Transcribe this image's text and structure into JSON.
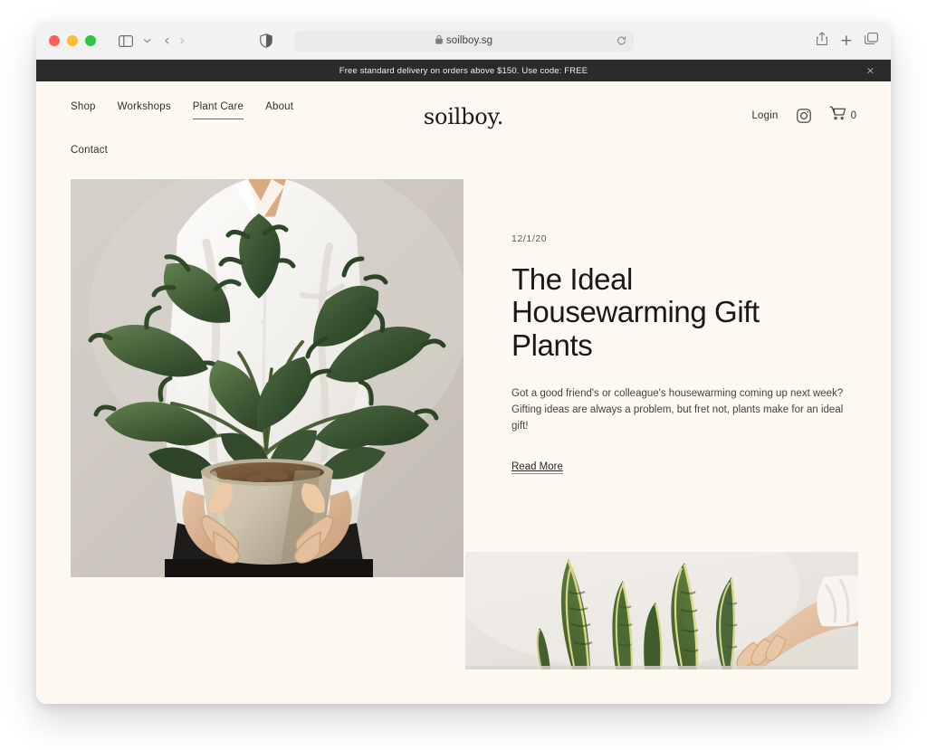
{
  "browser": {
    "url": "soilboy.sg",
    "lock_icon": "lock-icon",
    "traffic_lights": [
      "close",
      "minimize",
      "maximize"
    ],
    "sidebar_icon": "sidebar-toggle-icon",
    "sidebar_chevron_icon": "chevron-down-icon",
    "back_icon": "‹",
    "forward_icon": "›",
    "shield_icon": "privacy-shield-icon",
    "reload_icon": "reload-icon",
    "share_icon": "share-icon",
    "new_tab_icon": "+",
    "tabs_icon": "tab-overview-icon"
  },
  "announcement": {
    "text": "Free standard delivery on orders above $150. Use code: FREE",
    "close_label": "×",
    "background": "#2b2b2b",
    "text_color": "#f2f0ec"
  },
  "header": {
    "brand": "soilboy.",
    "nav": [
      {
        "label": "Shop",
        "active": false
      },
      {
        "label": "Workshops",
        "active": false
      },
      {
        "label": "Plant Care",
        "active": true
      },
      {
        "label": "About",
        "active": false
      },
      {
        "label": "Contact",
        "active": false
      }
    ],
    "login_label": "Login",
    "instagram_icon": "instagram-icon",
    "cart_icon": "shopping-cart-icon",
    "cart_count": "0"
  },
  "article": {
    "date": "12/1/20",
    "title": "The Ideal Housewarming Gift Plants",
    "excerpt": "Got a good friend's or colleague's housewarming coming up next week? Gifting ideas are always a problem, but fret not, plants make for an ideal gift!",
    "read_more_label": "Read More",
    "hero_image_alt": "Person in white shirt holding a potted philodendron plant",
    "secondary_image_alt": "Hand reaching toward a snake plant"
  },
  "theme": {
    "page_background": "#fdf8f2",
    "text_primary": "#1b1915",
    "text_muted": "#5e5a53",
    "accent_dark": "#2b2b2b"
  }
}
